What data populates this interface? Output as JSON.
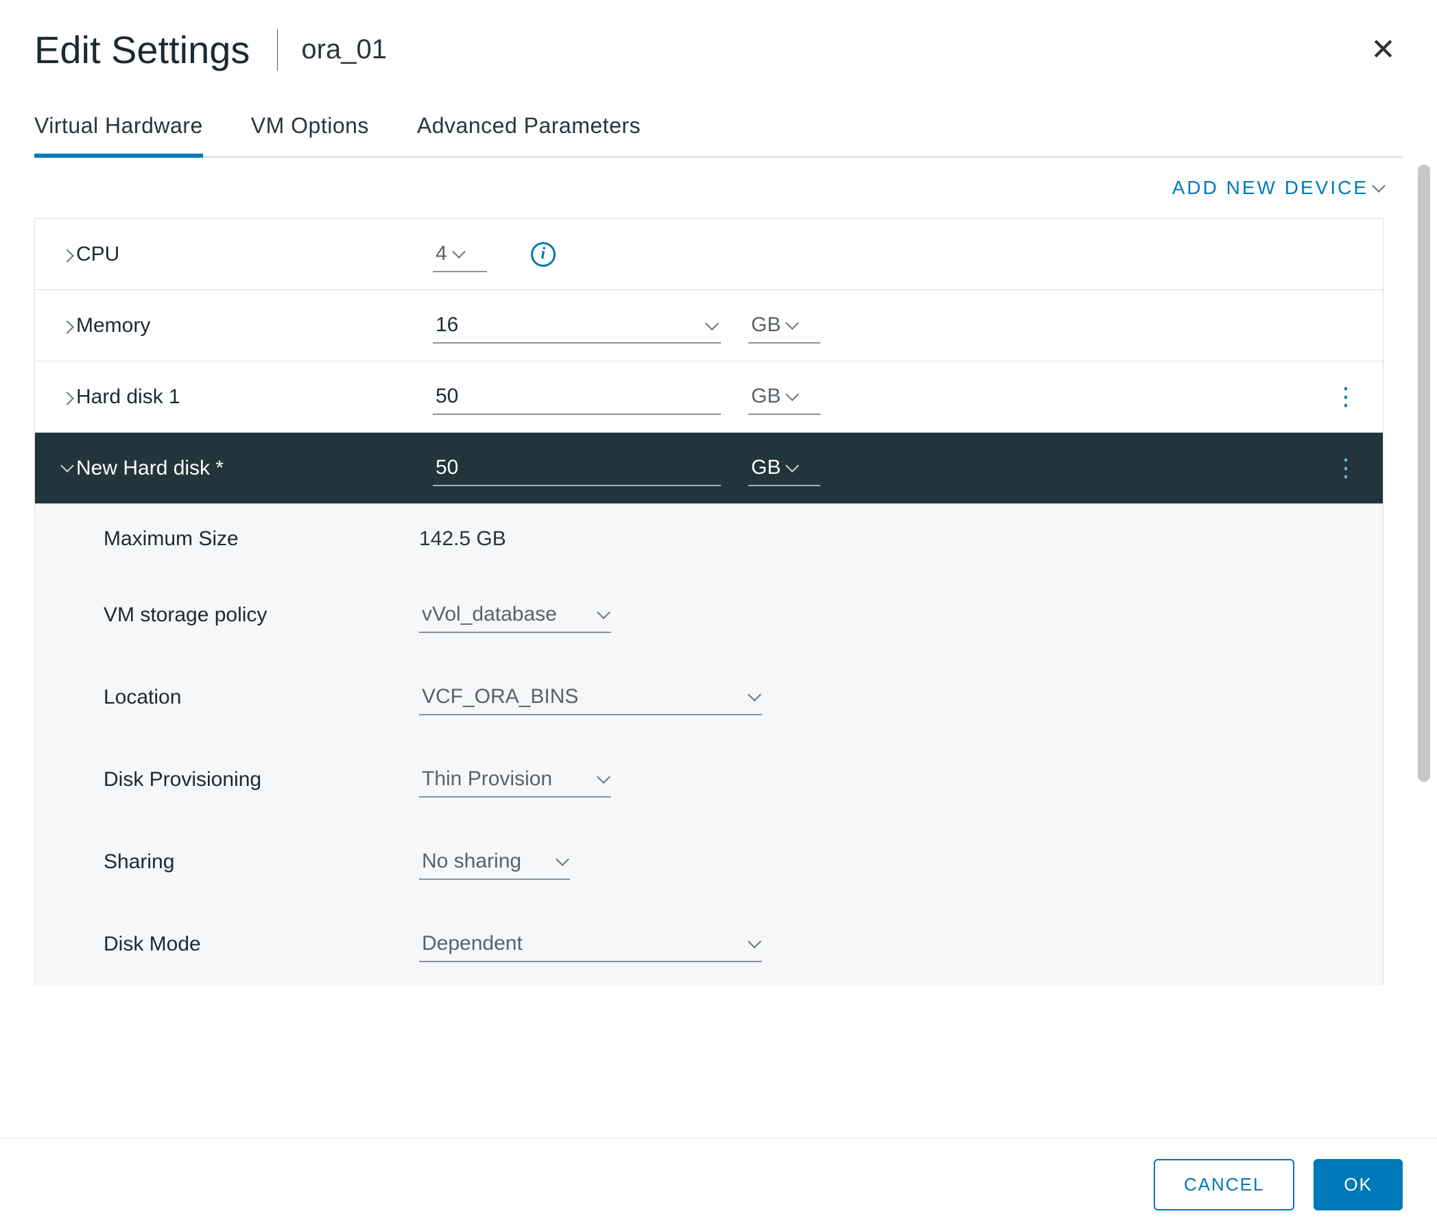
{
  "header": {
    "title": "Edit Settings",
    "vm_name": "ora_01"
  },
  "tabs": {
    "virtual_hardware": "Virtual Hardware",
    "vm_options": "VM Options",
    "advanced_parameters": "Advanced Parameters"
  },
  "actions": {
    "add_new_device": "ADD NEW DEVICE"
  },
  "hardware": {
    "cpu": {
      "label": "CPU",
      "value": "4"
    },
    "memory": {
      "label": "Memory",
      "value": "16",
      "unit": "GB"
    },
    "hard_disk_1": {
      "label": "Hard disk 1",
      "value": "50",
      "unit": "GB"
    },
    "new_hard_disk": {
      "label": "New Hard disk *",
      "value": "50",
      "unit": "GB",
      "details": {
        "maximum_size": {
          "label": "Maximum Size",
          "value": "142.5 GB"
        },
        "vm_storage_policy": {
          "label": "VM storage policy",
          "value": "vVol_database"
        },
        "location": {
          "label": "Location",
          "value": "VCF_ORA_BINS"
        },
        "disk_provisioning": {
          "label": "Disk Provisioning",
          "value": "Thin Provision"
        },
        "sharing": {
          "label": "Sharing",
          "value": "No sharing"
        },
        "disk_mode": {
          "label": "Disk Mode",
          "value": "Dependent"
        }
      }
    }
  },
  "footer": {
    "cancel": "CANCEL",
    "ok": "OK"
  }
}
